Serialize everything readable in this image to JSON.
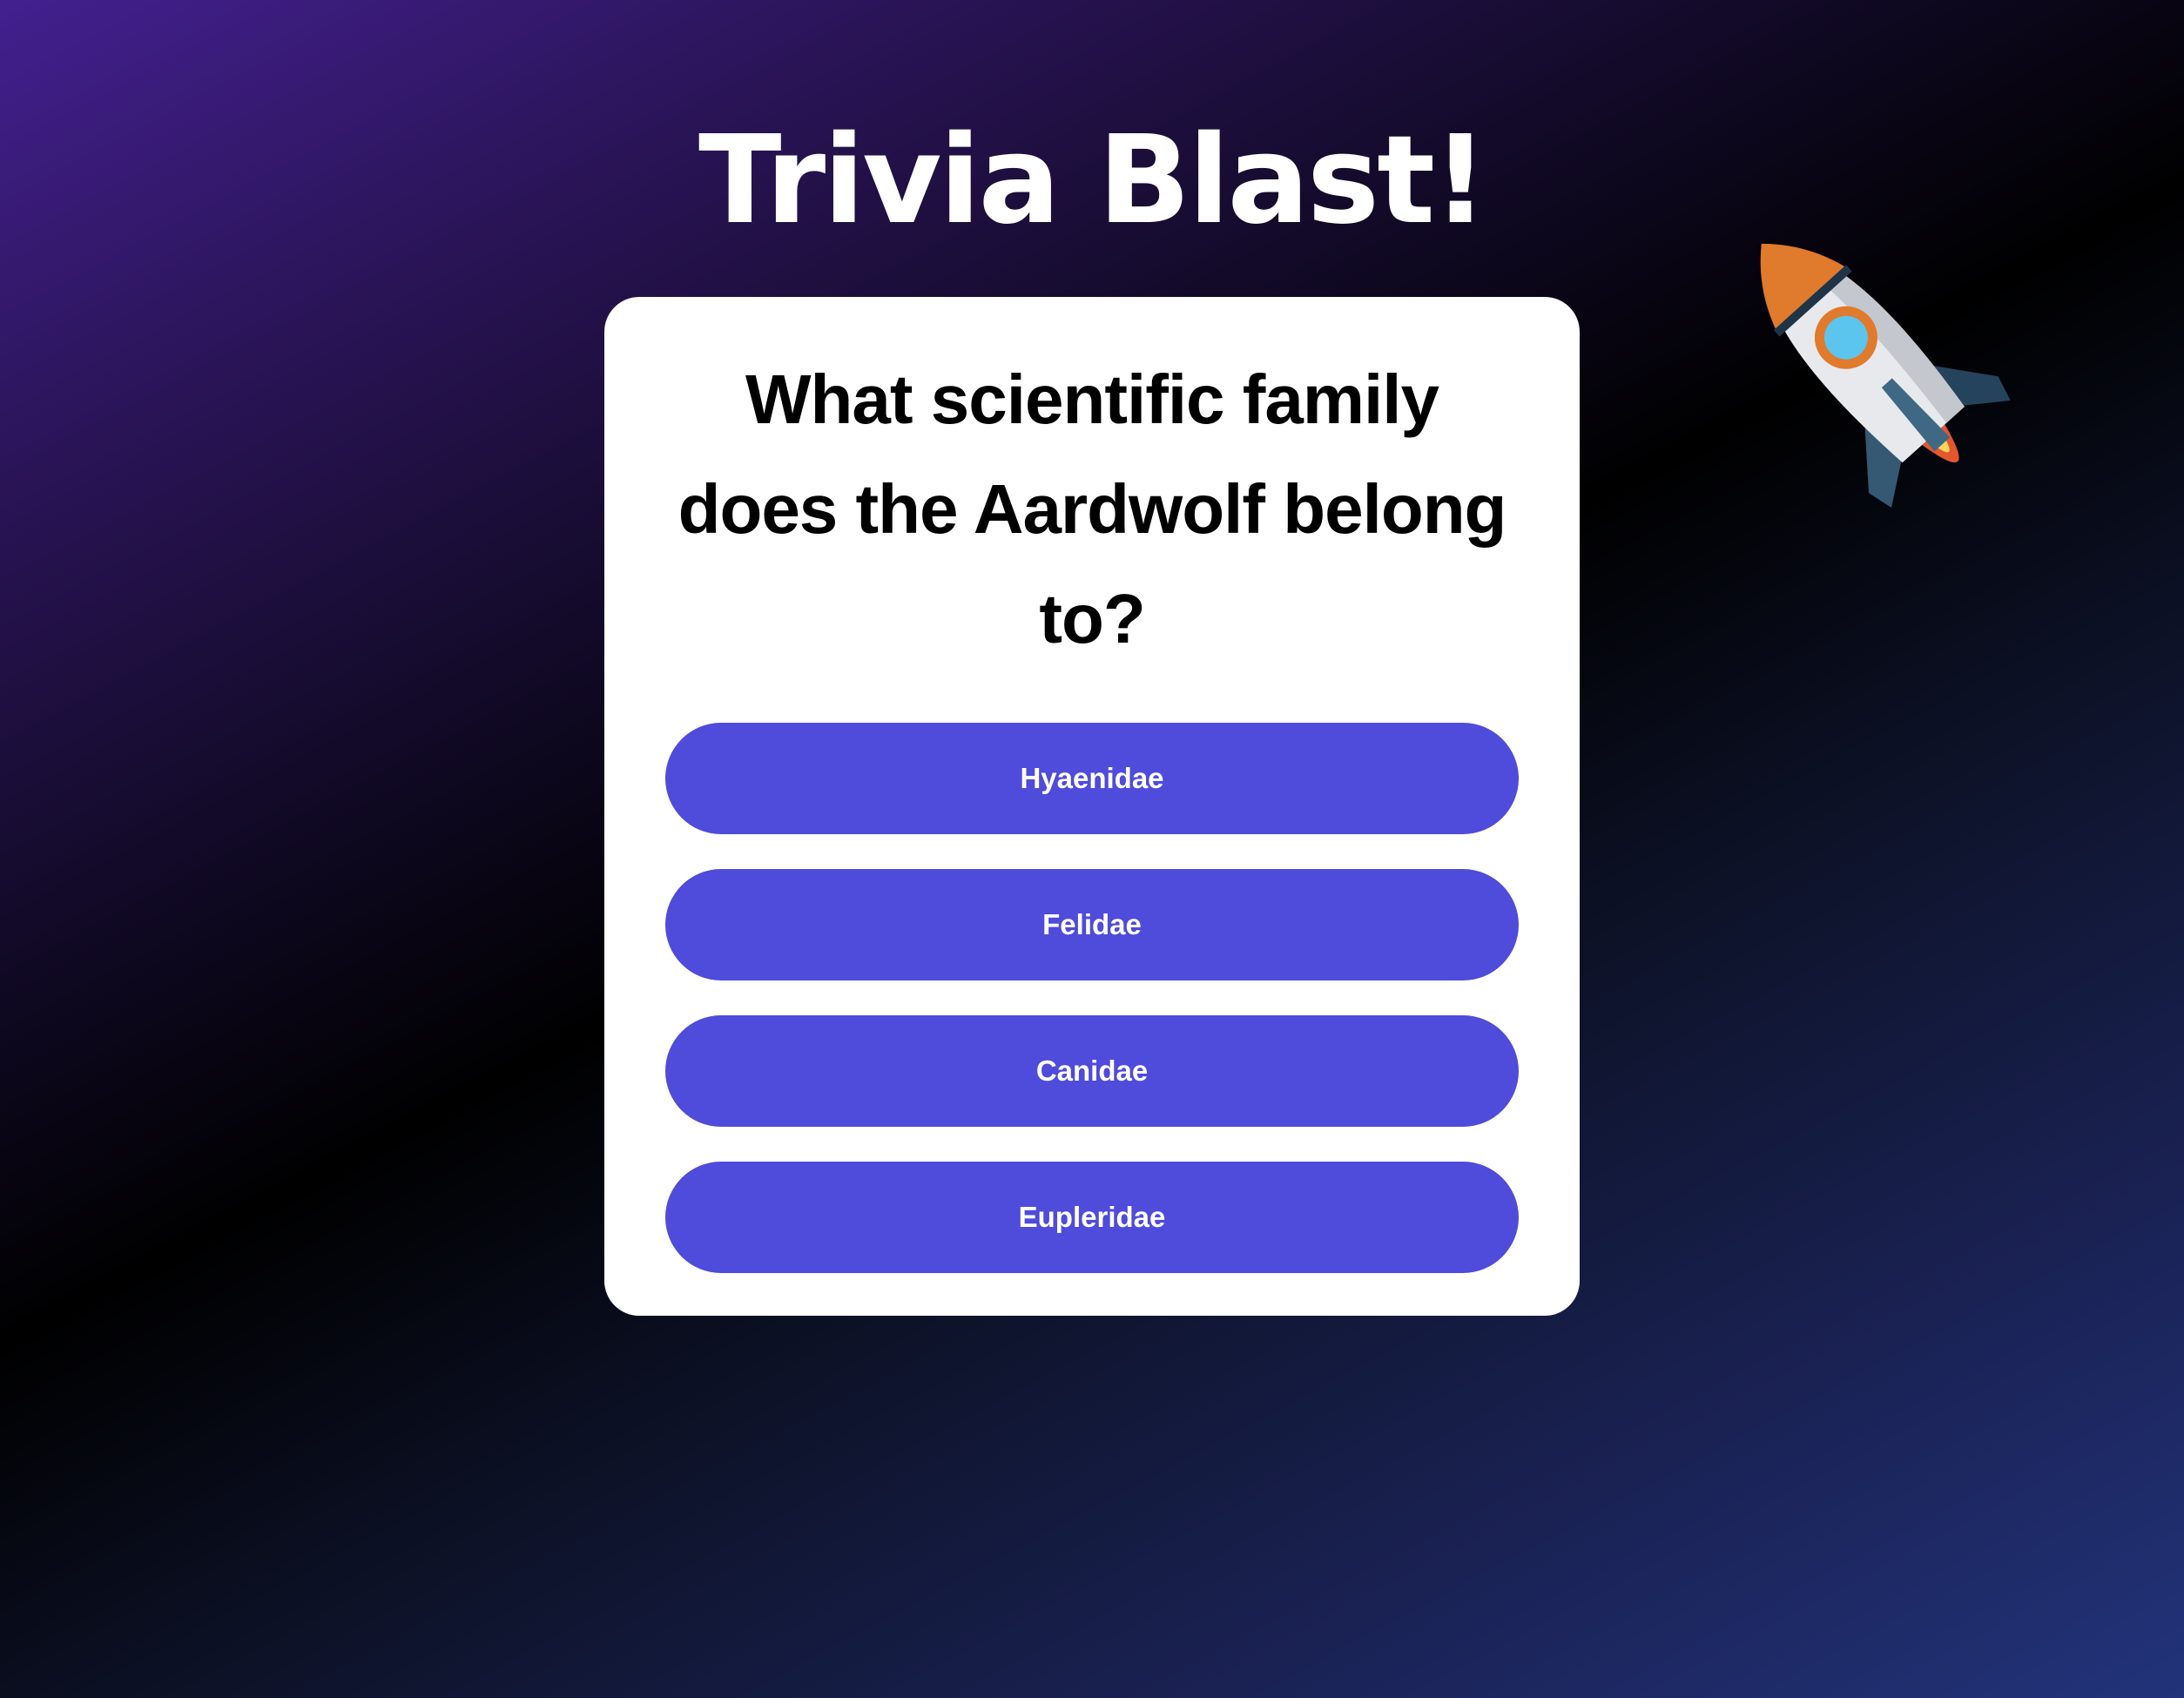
{
  "header": {
    "title": "Trivia Blast!",
    "decoration_icon": "rocket-icon"
  },
  "quiz": {
    "question": "What scientific family does the Aardwolf belong to?",
    "answers": [
      {
        "label": "Hyaenidae"
      },
      {
        "label": "Felidae"
      },
      {
        "label": "Canidae"
      },
      {
        "label": "Eupleridae"
      }
    ]
  },
  "colors": {
    "button": "#4f4bdb",
    "card": "#ffffff",
    "background_top_left": "#43208f",
    "background_bottom_right": "#22337a"
  }
}
